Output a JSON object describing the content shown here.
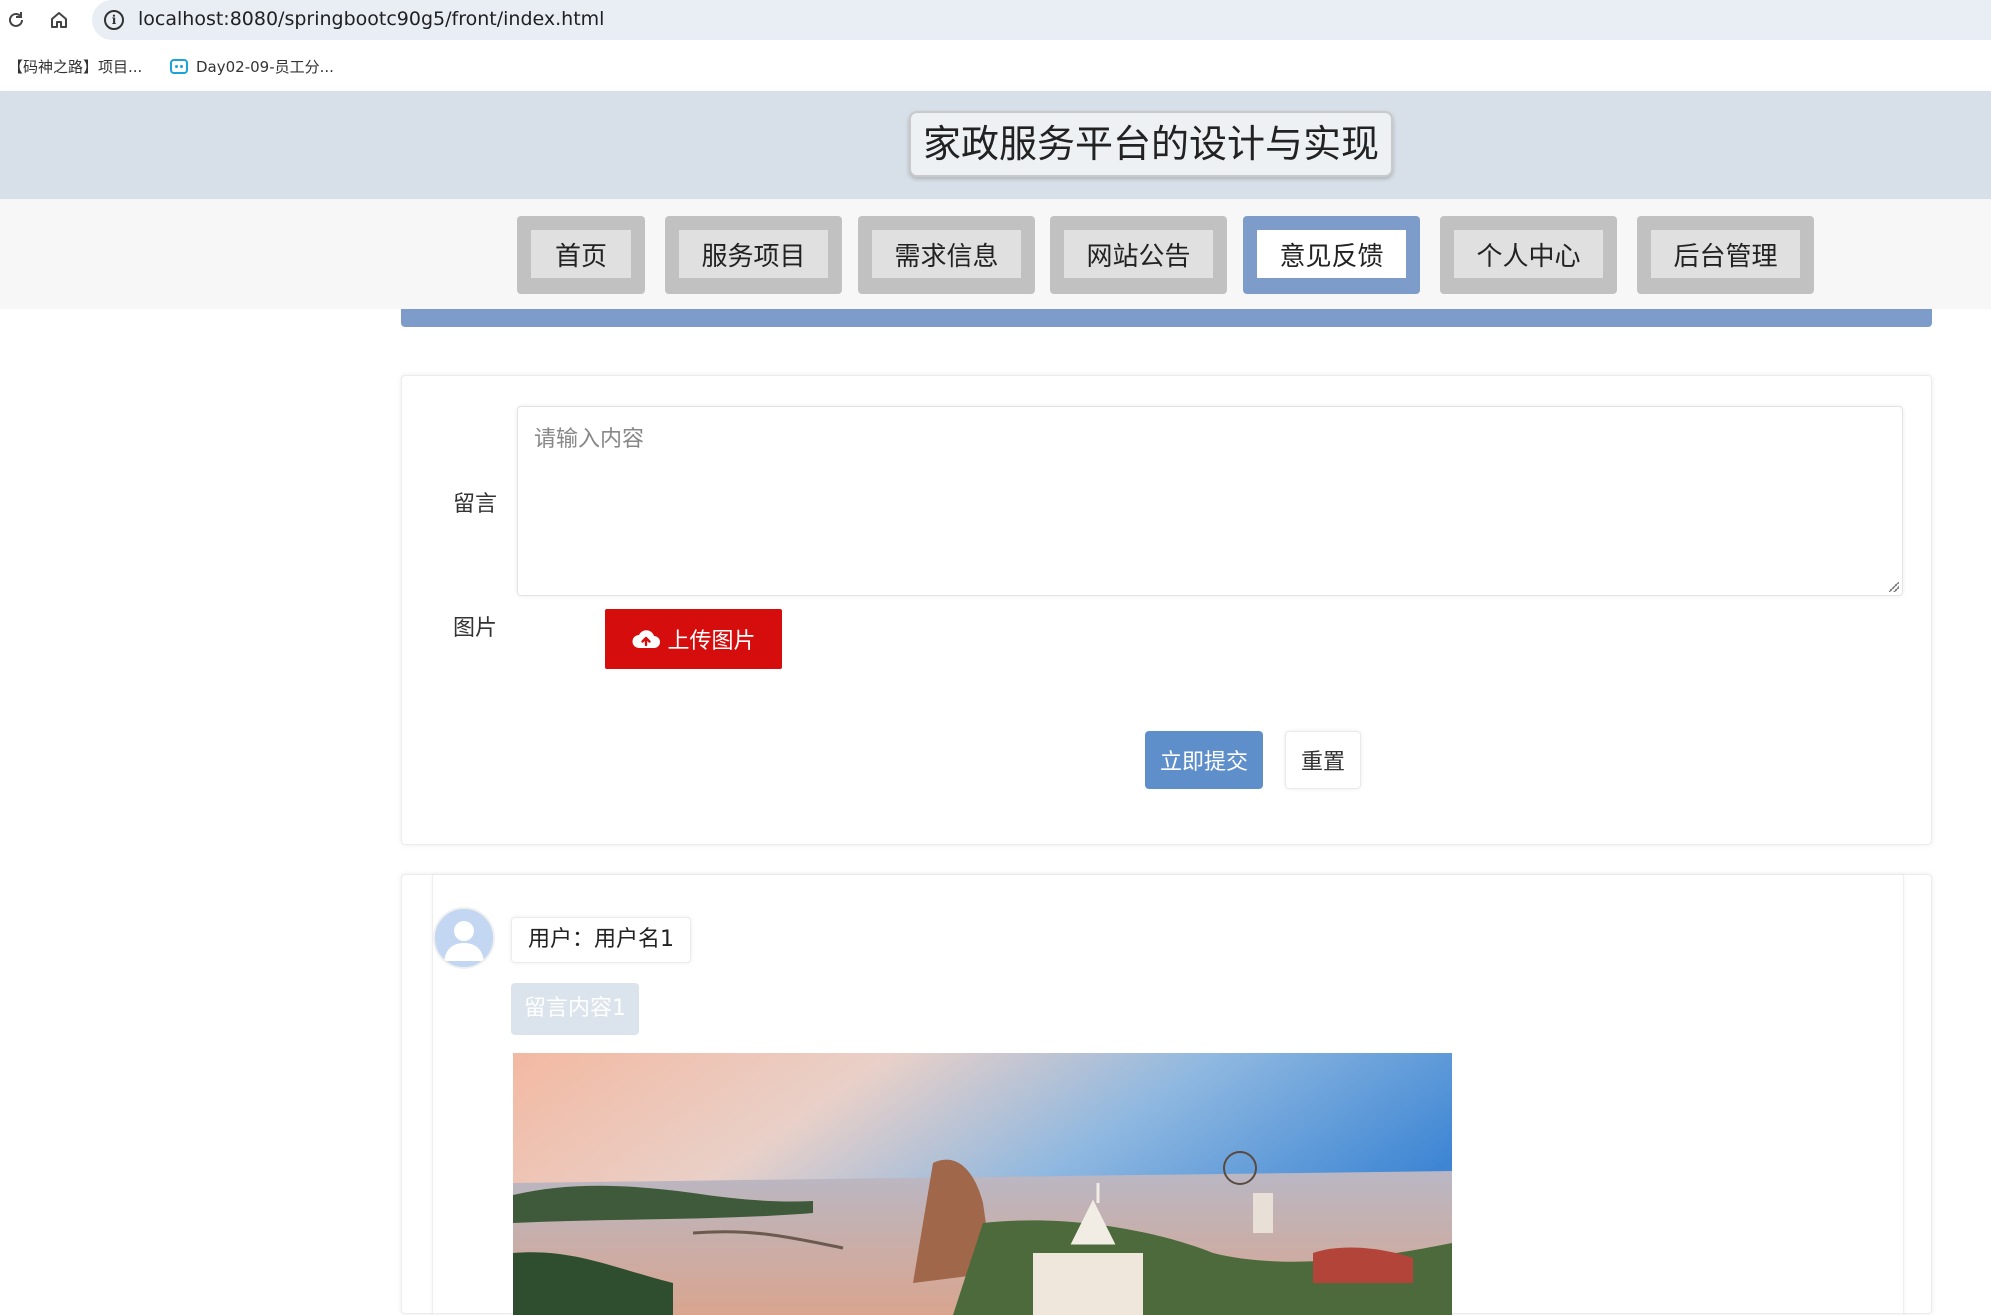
{
  "browser": {
    "url": "localhost:8080/springbootc90g5/front/index.html",
    "bookmarks": [
      "【码神之路】项目...",
      "Day02-09-员工分..."
    ]
  },
  "site": {
    "title": "家政服务平台的设计与实现"
  },
  "nav": {
    "tabs": [
      "首页",
      "服务项目",
      "需求信息",
      "网站公告",
      "意见反馈",
      "个人中心",
      "后台管理"
    ],
    "active": "意见反馈"
  },
  "form": {
    "message_label": "留言",
    "message_placeholder": "请输入内容",
    "message_value": "",
    "image_label": "图片",
    "upload_label": "上传图片",
    "submit_label": "立即提交",
    "reset_label": "重置"
  },
  "messages": [
    {
      "user": "用户：用户名1",
      "content": "留言内容1"
    }
  ],
  "colors": {
    "accent": "#7e9cc9",
    "submit": "#5f8fcb",
    "upload": "#d60d0d",
    "header_bg": "#d7dfe8"
  }
}
